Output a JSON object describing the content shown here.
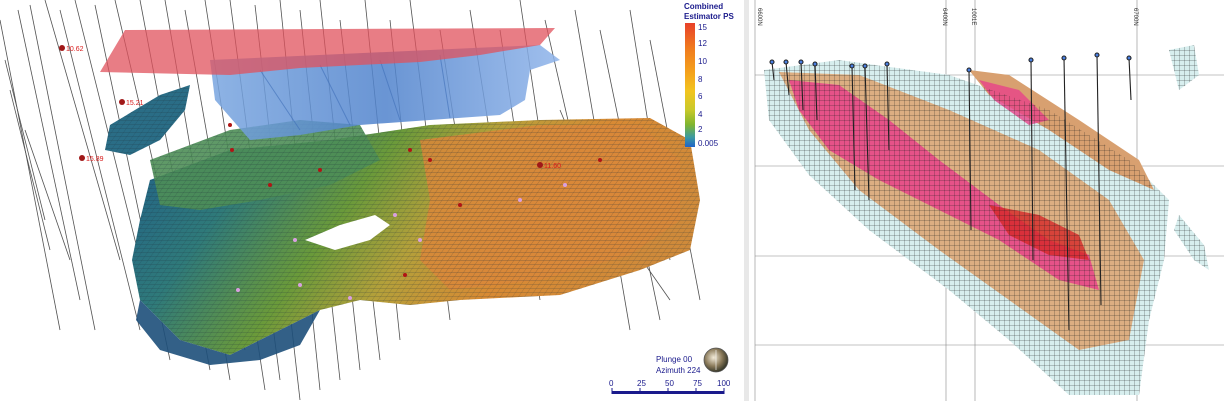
{
  "legend": {
    "title_line1": "Combined",
    "title_line2": "Estimator PS",
    "ticks": [
      "15",
      "12",
      "10",
      "8",
      "6",
      "4",
      "2",
      "0.005"
    ],
    "colors": [
      "#e8412a",
      "#f07a1e",
      "#f4a21c",
      "#f2c41f",
      "#c9c92a",
      "#7fb52f",
      "#3d9ba0",
      "#1e63c8"
    ]
  },
  "drill_labels": [
    "10.62",
    "15.21",
    "15.89",
    "11.60"
  ],
  "orientation": {
    "plunge": "Plunge 00",
    "azimuth": "Azimuth 224"
  },
  "scale_bar": {
    "ticks": [
      "0",
      "25",
      "50",
      "75",
      "100"
    ]
  },
  "section": {
    "grid_labels": [
      "6600N",
      "6400N",
      "1001E",
      "6700N"
    ]
  },
  "colors": {
    "pit_top": "#e0525c",
    "pit_wall": "#5b8fd4",
    "block_high": "#e8412a",
    "block_low": "#1e5aa6",
    "section_pink": "#e8428a",
    "section_tan": "#d8a070",
    "section_cyan": "#cfeaea"
  }
}
